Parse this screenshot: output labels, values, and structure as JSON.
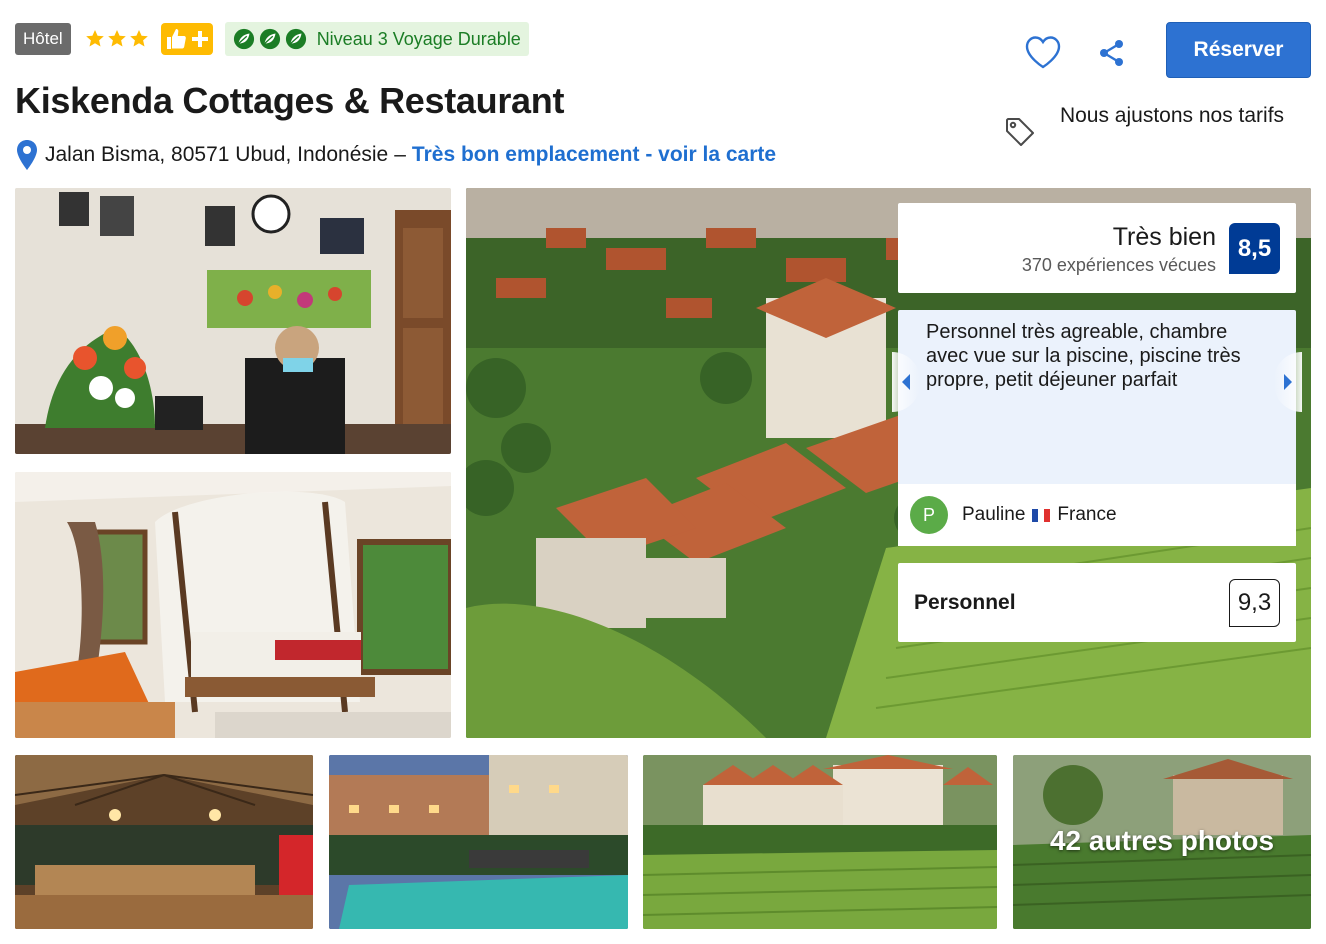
{
  "header": {
    "hotel_badge": "Hôtel",
    "stars": 3,
    "sustainability_label": "Niveau 3 Voyage Durable",
    "title": "Kiskenda Cottages & Restaurant",
    "address": "Jalan Bisma, 80571 Ubud, Indonésie",
    "address_separator": "–",
    "map_link": "Très bon emplacement - voir la carte"
  },
  "actions": {
    "reserve_label": "Réserver",
    "price_note": "Nous ajustons nos tarifs",
    "icons": [
      "heart-icon",
      "share-icon",
      "tag-icon",
      "map-pin-icon"
    ]
  },
  "gallery": {
    "more_photos_label": "42 autres photos"
  },
  "review": {
    "rating_label": "Très bien",
    "rating_count": "370 expériences vécues",
    "score": "8,5",
    "quote": "Personnel très agreable, chambre avec vue sur la piscine, piscine très propre, petit déjeuner parfait",
    "reviewer_initial": "P",
    "reviewer_name": "Pauline",
    "reviewer_country": "France",
    "category_label": "Personnel",
    "category_score": "9,3"
  },
  "colors": {
    "accent_blue": "#2d72d2",
    "score_navy": "#003b95",
    "link_blue": "#1f6fd0",
    "sustain_green": "#1b7d25",
    "star_yellow": "#febb02"
  }
}
